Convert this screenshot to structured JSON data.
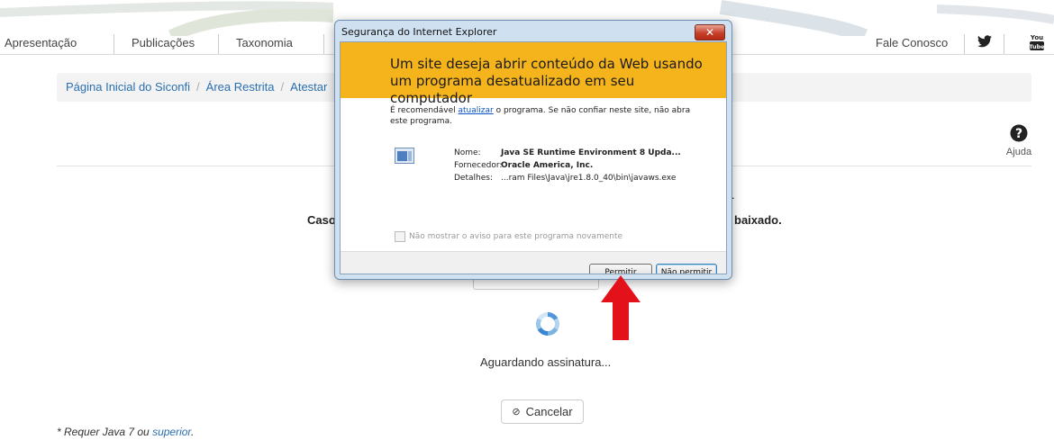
{
  "nav": {
    "left": [
      "Apresentação",
      "Publicações",
      "Taxonomia"
    ],
    "right_link": "Fale Conosco",
    "icons": [
      "twitter-icon",
      "youtube-icon"
    ]
  },
  "breadcrumb": [
    "Página Inicial do Siconfi",
    "Área Restrita",
    "Atestar"
  ],
  "help": {
    "label": "Ajuda",
    "icon": "question-circle-icon"
  },
  "page": {
    "message_left": "Caso",
    "message_right": "baixado.",
    "message_dot": ".",
    "waiting": "Aguardando assinatura...",
    "cancel": "Cancelar",
    "footnote_text": "* Requer Java 7 ou ",
    "footnote_link": "superior",
    "footnote_end": "."
  },
  "dialog": {
    "title": "Segurança do Internet Explorer",
    "headline": "Um site deseja abrir conteúdo da Web usando um programa desatualizado em seu computador",
    "rec_before": "É recomendável ",
    "rec_link": "atualizar",
    "rec_after": " o programa. Se não confiar neste site, não abra este programa.",
    "name_label": "Nome:",
    "name_value": "Java SE Runtime Environment 8 Upda...",
    "vendor_label": "Fornecedor:",
    "vendor_value": "Oracle America, Inc.",
    "details_label": "Detalhes:",
    "details_value": "...ram Files\\Java\\jre1.8.0_40\\bin\\javaws.exe",
    "checkbox": "Não mostrar o aviso para este programa novamente",
    "allow": "Permitir",
    "deny": "Não permitir"
  },
  "colors": {
    "warning_banner": "#f5b41c",
    "arrow": "#e3121a",
    "link": "#2a6fb0"
  }
}
